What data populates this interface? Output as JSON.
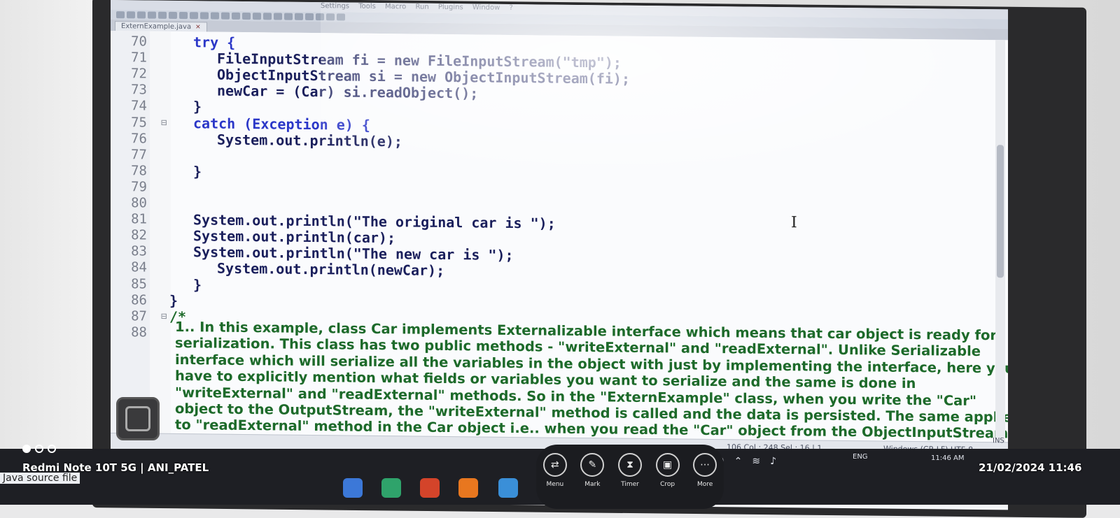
{
  "menubar": {
    "items": [
      "Settings",
      "Tools",
      "Macro",
      "Run",
      "Plugins",
      "Window",
      "?"
    ]
  },
  "tab": {
    "filename": "ExternExample.java",
    "close_glyph": "✕"
  },
  "code_lines": [
    {
      "num": "70",
      "fold": "",
      "text": "try {",
      "indent": 0,
      "kind": "kw"
    },
    {
      "num": "71",
      "fold": "",
      "text": "FileInputStream fi = new FileInputStream(\"tmp\");",
      "indent": 1,
      "kind": "code"
    },
    {
      "num": "72",
      "fold": "",
      "text": "ObjectInputStream si = new ObjectInputStream(fi);",
      "indent": 1,
      "kind": "code"
    },
    {
      "num": "73",
      "fold": "",
      "text": "newCar = (Car) si.readObject();",
      "indent": 1,
      "kind": "code"
    },
    {
      "num": "74",
      "fold": "",
      "text": "}",
      "indent": 0,
      "kind": "code"
    },
    {
      "num": "75",
      "fold": "⊟",
      "text": "catch (Exception e) {",
      "indent": 0,
      "kind": "kw"
    },
    {
      "num": "76",
      "fold": "",
      "text": "System.out.println(e);",
      "indent": 1,
      "kind": "code"
    },
    {
      "num": "77",
      "fold": "",
      "text": "",
      "indent": 0,
      "kind": "code"
    },
    {
      "num": "78",
      "fold": "",
      "text": "}",
      "indent": 0,
      "kind": "code"
    },
    {
      "num": "79",
      "fold": "",
      "text": "",
      "indent": 0,
      "kind": "code"
    },
    {
      "num": "80",
      "fold": "",
      "text": "",
      "indent": 0,
      "kind": "code"
    },
    {
      "num": "81",
      "fold": "",
      "text": "System.out.println(\"The original car is \");",
      "indent": 0,
      "kind": "code"
    },
    {
      "num": "82",
      "fold": "",
      "text": "System.out.println(car);",
      "indent": 0,
      "kind": "code"
    },
    {
      "num": "83",
      "fold": "",
      "text": "System.out.println(\"The new car is \");",
      "indent": 0,
      "kind": "code"
    },
    {
      "num": "84",
      "fold": "",
      "text": "System.out.println(newCar);",
      "indent": 1,
      "kind": "code"
    },
    {
      "num": "85",
      "fold": "",
      "text": "}",
      "indent": 0,
      "kind": "code"
    },
    {
      "num": "86",
      "fold": "",
      "text": "}",
      "indent": -1,
      "kind": "code"
    },
    {
      "num": "87",
      "fold": "⊟",
      "text": "/*",
      "indent": -1,
      "kind": "comment"
    },
    {
      "num": "88",
      "fold": "",
      "text": "",
      "indent": 0,
      "kind": "code"
    }
  ],
  "comment_lines": [
    "1..  In this example, class Car implements Externalizable interface which means that car object is ready for",
    "serialization. This class has two public methods - \"writeExternal\" and \"readExternal\". Unlike Serializable",
    "interface which will serialize all the variables in the object with just by implementing the interface, here you",
    "have to explicitly mention what fields or variables you want to serialize and the same is done in",
    "\"writeExternal\" and \"readExternal\" methods. So in the \"ExternExample\" class, when you write the \"Car\"",
    "object to the OutputStream, the \"writeExternal\" method is called and the data is persisted. The same applies",
    "to \"readExternal\" method in the Car object i.e.. when you read the \"Car\" object from the ObjectInputStream,"
  ],
  "statusbar": {
    "position": "106   Col : 248   Sel : 16 | 1",
    "eol": "Windows (CR LF)",
    "encoding": "UTF-8",
    "mode": "INS"
  },
  "file_type": "Java source file",
  "overlay_toolbar": [
    {
      "label": "Menu",
      "icon": "menu-icon",
      "glyph": "⇄"
    },
    {
      "label": "Mark",
      "icon": "pen-icon",
      "glyph": "✎"
    },
    {
      "label": "Timer",
      "icon": "hourglass-icon",
      "glyph": "⧗"
    },
    {
      "label": "Crop",
      "icon": "crop-icon",
      "glyph": "▣"
    },
    {
      "label": "More",
      "icon": "more-icon",
      "glyph": "⋯"
    }
  ],
  "tray": {
    "language": "ENG",
    "time": "11:46 AM"
  },
  "photo_overlay": {
    "device": "Redmi Note 10T 5G | ANI_PATEL",
    "datetime": "21/02/2024  11:46"
  },
  "colors": {
    "keyword": "#2b37c8",
    "code": "#1a1f5c",
    "comment": "#1d6a2a",
    "string": "#7a1a1a"
  }
}
